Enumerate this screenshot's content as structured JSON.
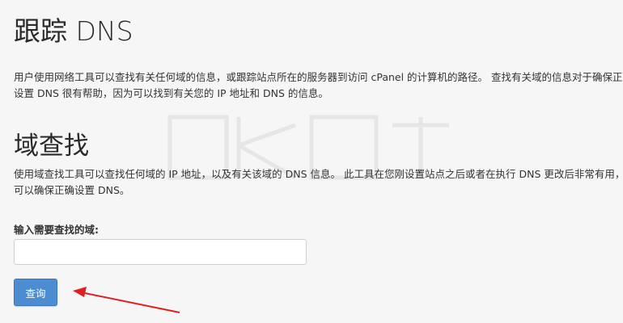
{
  "page": {
    "title": "跟踪 DNS",
    "description": "用户使用网络工具可以查找有关任何域的信息，或跟踪站点所在的服务器到访问 cPanel 的计算机的路径。 查找有关域的信息对于确保正确设置 DNS 很有帮助，因为可以找到有关您的 IP 地址和 DNS 的信息。"
  },
  "domain_lookup": {
    "title": "域查找",
    "description": "使用域查找工具可以查找任何域的 IP 地址，以及有关该域的 DNS 信息。 此工具在您刚设置站点之后或者在执行 DNS 更改后非常有用，它可以确保正确设置 DNS。",
    "field_label": "输入需要查找的域:",
    "field_value": "",
    "submit_label": "查询"
  },
  "colors": {
    "button": "#4b8dd0",
    "arrow": "#e02020",
    "background": "#f6f6f6"
  },
  "icons": [
    "red-arrow-annotation",
    "watermark-logo"
  ]
}
